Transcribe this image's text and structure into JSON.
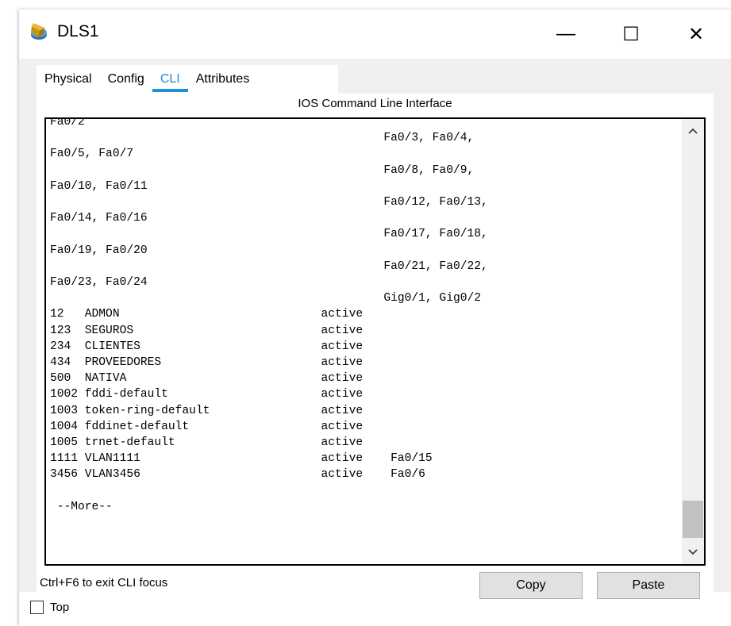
{
  "window": {
    "title": "DLS1",
    "minimize_glyph": "—",
    "maximize_glyph": "☐",
    "close_glyph": "✕",
    "icon": "router-icon"
  },
  "tabs": [
    {
      "label": "Physical",
      "active": false
    },
    {
      "label": "Config",
      "active": false
    },
    {
      "label": "CLI",
      "active": true
    },
    {
      "label": "Attributes",
      "active": false
    }
  ],
  "cli": {
    "header": "IOS Command Line Interface",
    "lines": [
      "Fa0/2",
      "                                                Fa0/3, Fa0/4,",
      "Fa0/5, Fa0/7",
      "                                                Fa0/8, Fa0/9,",
      "Fa0/10, Fa0/11",
      "                                                Fa0/12, Fa0/13,",
      "Fa0/14, Fa0/16",
      "                                                Fa0/17, Fa0/18,",
      "Fa0/19, Fa0/20",
      "                                                Fa0/21, Fa0/22,",
      "Fa0/23, Fa0/24",
      "                                                Gig0/1, Gig0/2",
      "12   ADMON                             active",
      "123  SEGUROS                           active",
      "234  CLIENTES                          active",
      "434  PROVEEDORES                       active",
      "500  NATIVA                            active",
      "1002 fddi-default                      active",
      "1003 token-ring-default                active",
      "1004 fddinet-default                   active",
      "1005 trnet-default                     active",
      "1111 VLAN1111                          active    Fa0/15",
      "3456 VLAN3456                          active    Fa0/6",
      "",
      " --More--"
    ],
    "hint": "Ctrl+F6 to exit CLI focus",
    "copy_label": "Copy",
    "paste_label": "Paste"
  },
  "footer": {
    "top_label": "Top",
    "top_checked": false
  }
}
